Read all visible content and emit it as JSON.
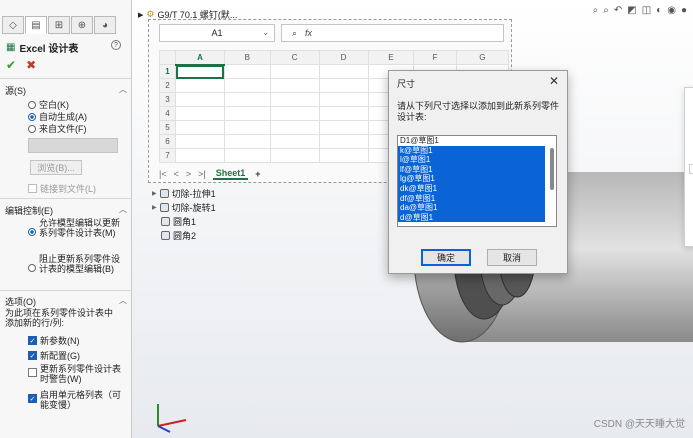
{
  "left_panel": {
    "title": "Excel 设计表",
    "help": "?",
    "ok": "✔",
    "cancel": "✖",
    "source": {
      "heading": "源(S)",
      "options": [
        "空白(K)",
        "自动生成(A)",
        "来自文件(F)"
      ],
      "selected": 1,
      "browse": "浏览(B)...",
      "link": "链接到文件(L)"
    },
    "edit_control": {
      "heading": "编辑控制(E)",
      "options": [
        "允许模型编辑以更新系列零件设计表(M)",
        "阻止更新系列零件设计表的模型编辑(B)"
      ],
      "selected": 0
    },
    "options": {
      "heading": "选项(O)",
      "desc": "为此项在系列零件设计表中添加新的行/列:",
      "checks": [
        {
          "label": "新参数(N)",
          "checked": true
        },
        {
          "label": "新配置(G)",
          "checked": true
        },
        {
          "label": "更新系列零件设计表时警告(W)",
          "checked": false
        },
        {
          "label": "启用单元格列表（可能变慢）",
          "checked": true
        }
      ]
    }
  },
  "viewport": {
    "breadcrumb": "G9/T 70.1 螺钉(默...",
    "tree": [
      "切除-拉伸1",
      "切除-旋转1",
      "圆角1",
      "圆角2"
    ]
  },
  "excel": {
    "cell_ref": "A1",
    "fx": "fx",
    "columns": [
      "A",
      "B",
      "C",
      "D",
      "E",
      "F",
      "G"
    ],
    "rows": [
      "1",
      "2",
      "3",
      "4",
      "5",
      "6",
      "7"
    ],
    "sheet_tab": "Sheet1",
    "add_sheet": "+"
  },
  "dim_dialog": {
    "title": "尺寸",
    "close": "✕",
    "prompt": "请从下列尺寸选择以添加到此新系列零件设计表:",
    "items": [
      {
        "label": "D1@草图1",
        "selected": false
      },
      {
        "label": "k@草图1",
        "selected": true
      },
      {
        "label": "l@草图1",
        "selected": true
      },
      {
        "label": "lf@草图1",
        "selected": true
      },
      {
        "label": "lg@草图1",
        "selected": true
      },
      {
        "label": "dk@草图1",
        "selected": true
      },
      {
        "label": "df@草图1",
        "selected": true
      },
      {
        "label": "da@草图1",
        "selected": true
      },
      {
        "label": "d@草图1",
        "selected": true
      }
    ],
    "ok": "确定",
    "cancel": "取消"
  },
  "bg_dialog": {
    "close": "✕"
  },
  "watermark": "CSDN @天天睡大觉"
}
